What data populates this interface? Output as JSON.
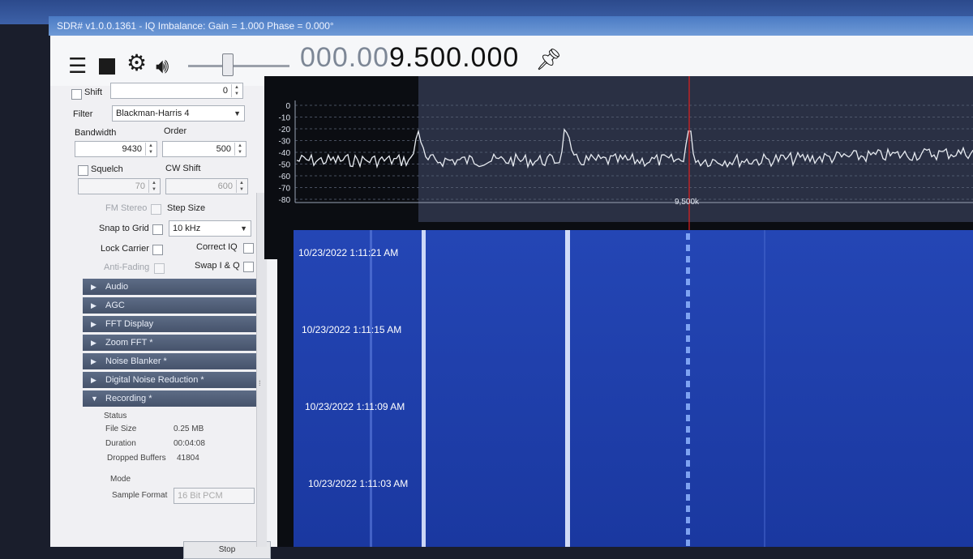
{
  "window": {
    "title": "SDR# v1.0.0.1361 - IQ Imbalance: Gain = 1.000 Phase = 0.000°"
  },
  "toolbar": {
    "menu_icon": "menu-icon",
    "stop_icon": "stop-icon",
    "settings_icon": "gear-icon",
    "audio_icon": "speaker-icon",
    "volume_level": 0.42,
    "frequency_dim": "000.00",
    "frequency_main": "9.500.000",
    "pin_icon": "pin-icon"
  },
  "panel": {
    "shift_label": "Shift",
    "shift_value": "0",
    "filter_label": "Filter",
    "filter_value": "Blackman-Harris 4",
    "bandwidth_label": "Bandwidth",
    "bandwidth_value": "9430",
    "order_label": "Order",
    "order_value": "500",
    "squelch_label": "Squelch",
    "squelch_value": "70",
    "cw_shift_label": "CW Shift",
    "cw_shift_value": "600",
    "fm_stereo_label": "FM Stereo",
    "step_size_label": "Step Size",
    "snap_to_grid_label": "Snap to Grid",
    "step_size_value": "10 kHz",
    "lock_carrier_label": "Lock Carrier",
    "correct_iq_label": "Correct IQ",
    "anti_fading_label": "Anti-Fading",
    "swap_iq_label": "Swap I & Q",
    "sections": [
      "Audio",
      "AGC",
      "FFT Display",
      "Zoom FFT *",
      "Noise Blanker *",
      "Digital Noise Reduction *",
      "Recording *"
    ],
    "recording": {
      "status_label": "Status",
      "file_size_label": "File Size",
      "file_size_value": "0.25 MB",
      "duration_label": "Duration",
      "duration_value": "00:04:08",
      "dropped_label": "Dropped Buffers",
      "dropped_value": "41804",
      "mode_label": "Mode",
      "sample_format_label": "Sample Format",
      "sample_format_value": "16 Bit PCM",
      "stop_label": "Stop"
    }
  },
  "spectrum": {
    "y_ticks": [
      "0",
      "-10",
      "-20",
      "-30",
      "-40",
      "-50",
      "-60",
      "-70",
      "-80"
    ],
    "center_label": "9,500k"
  },
  "waterfall": {
    "timestamps": [
      "10/23/2022 1:11:21 AM",
      "10/23/2022 1:11:15 AM",
      "10/23/2022 1:11:09 AM",
      "10/23/2022 1:11:03 AM"
    ]
  },
  "colors": {
    "waterfall_bg": "#1e3fae",
    "cursor": "#e02020",
    "trace": "#e8ecf2",
    "section_bar": "#4f5d77"
  }
}
